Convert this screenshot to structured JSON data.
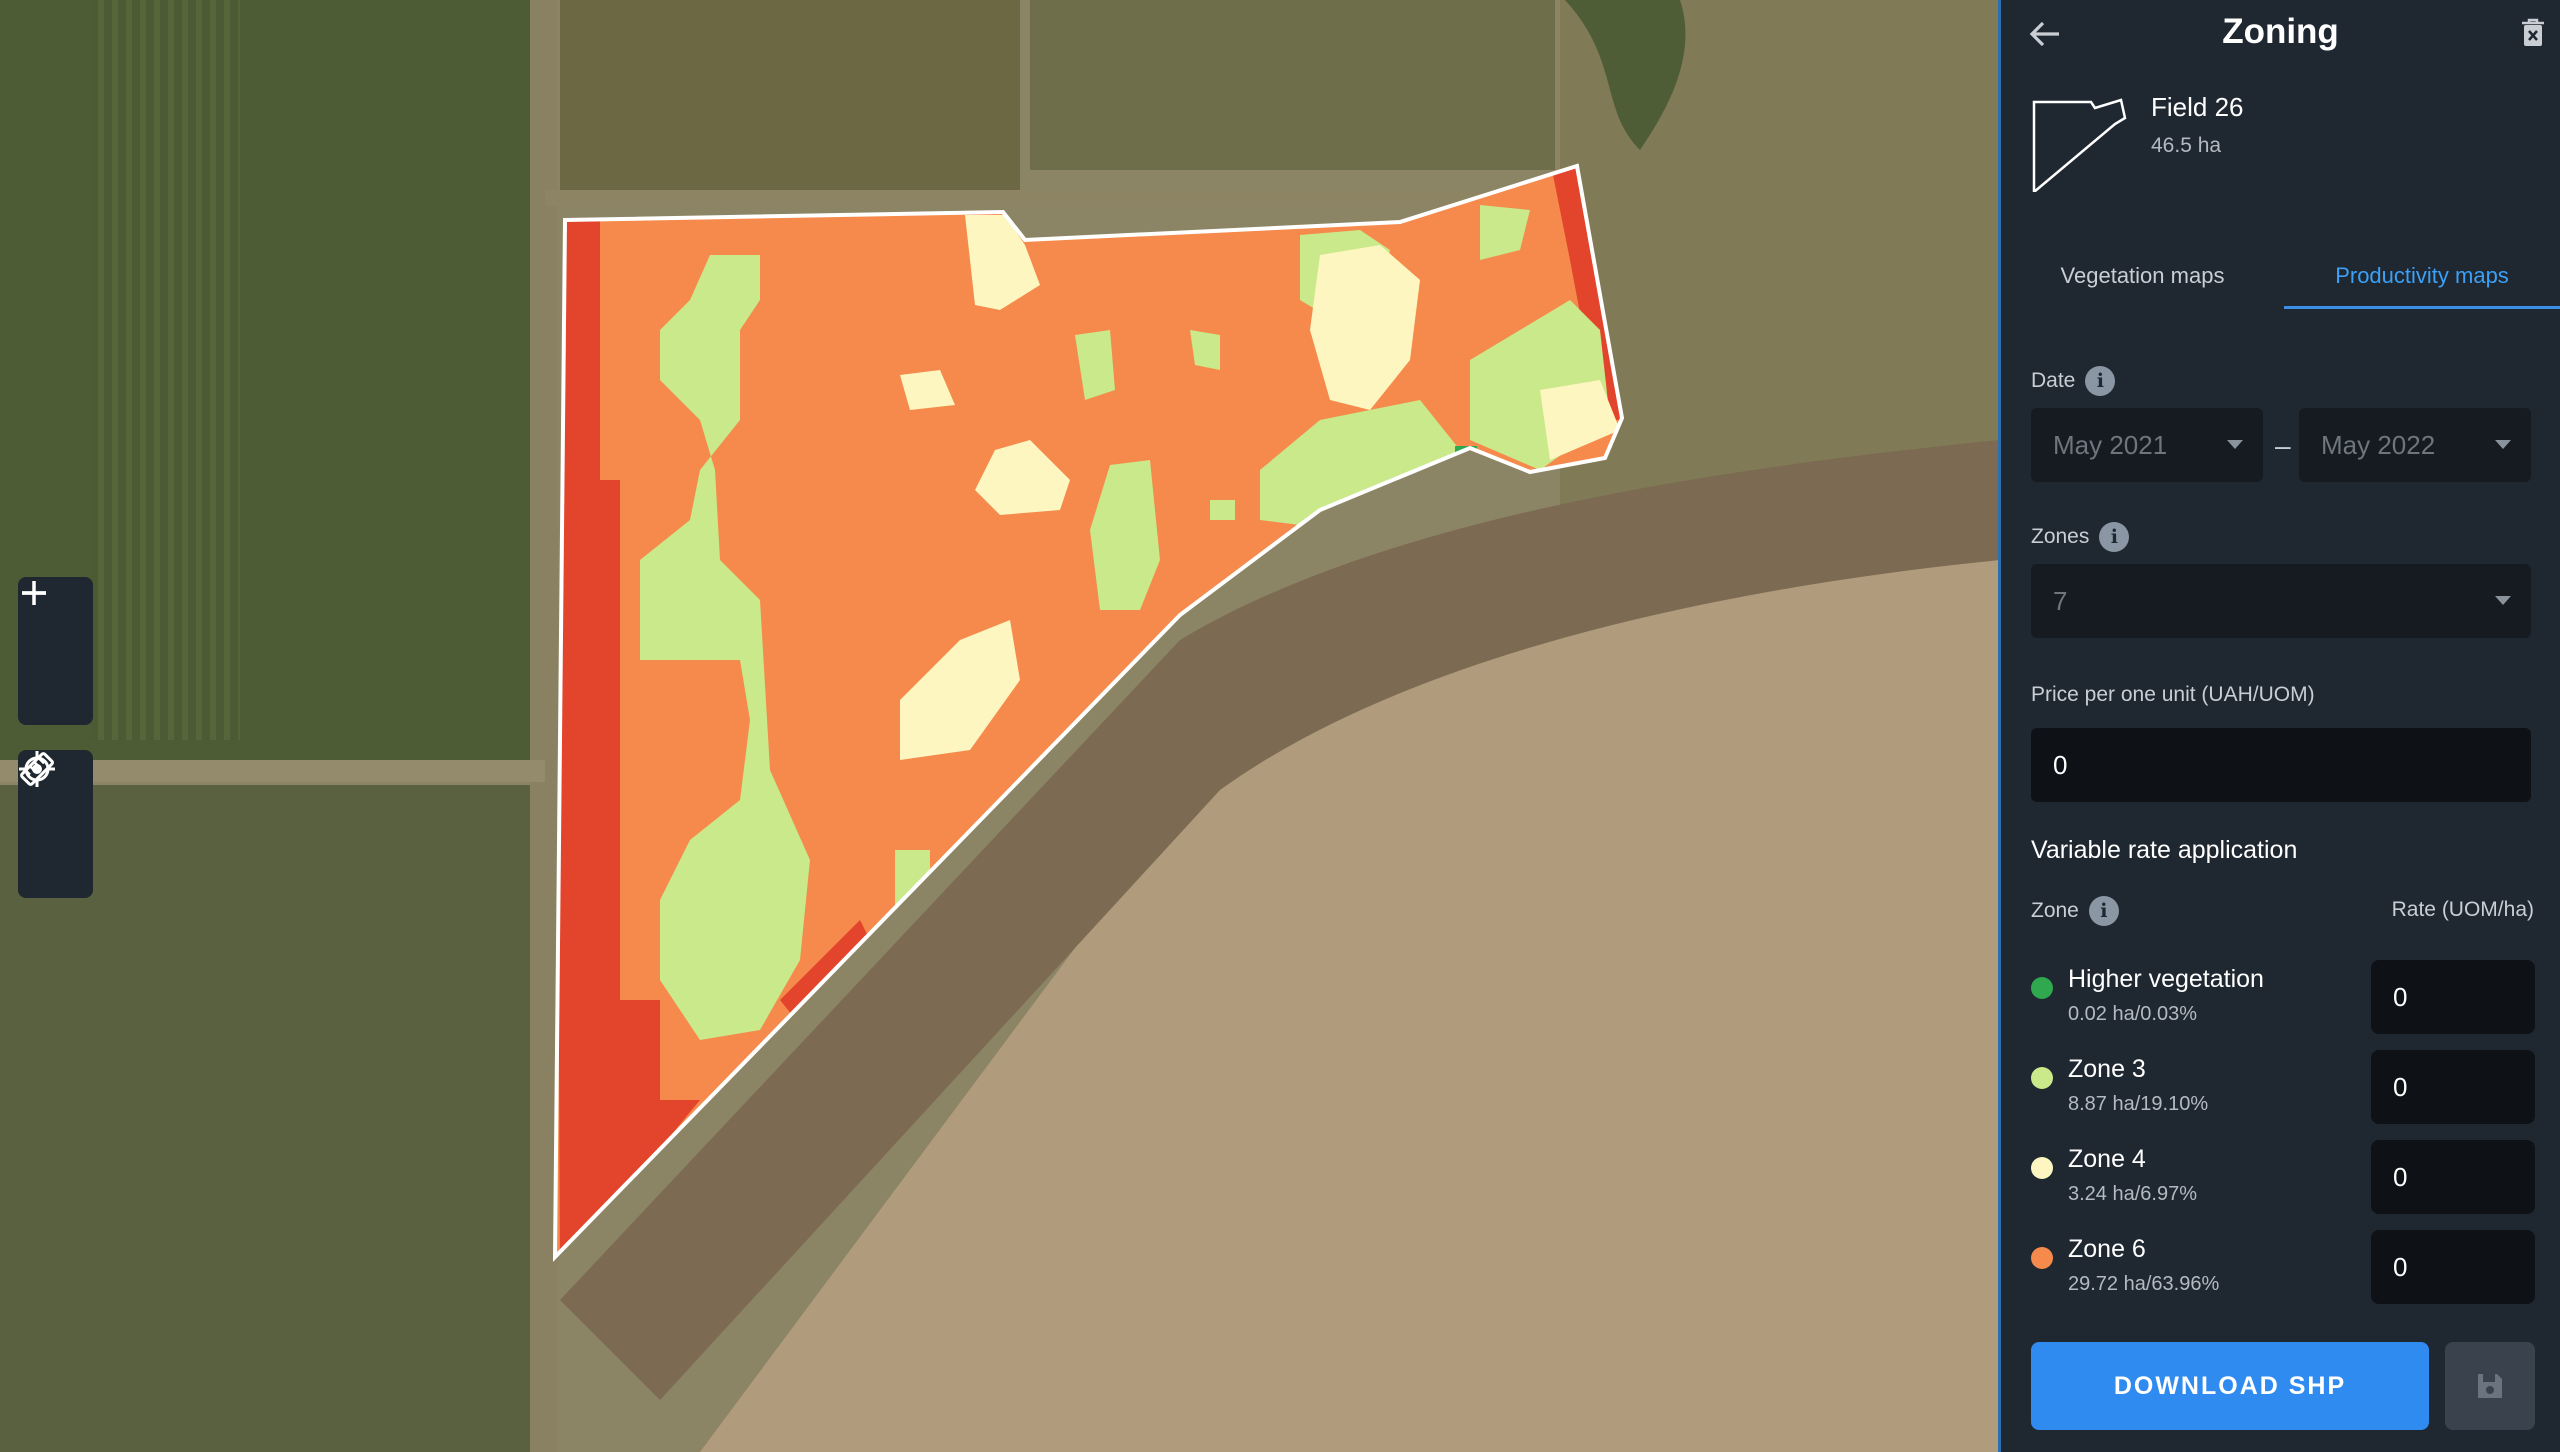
{
  "panel": {
    "title": "Zoning",
    "field_name": "Field 26",
    "field_area": "46.5 ha",
    "tabs": [
      {
        "label": "Vegetation maps",
        "active": false
      },
      {
        "label": "Productivity maps",
        "active": true
      }
    ],
    "date_label": "Date",
    "date_from": "May 2021",
    "date_to": "May 2022",
    "date_separator": "–",
    "zones_label": "Zones",
    "zones_value": "7",
    "price_label": "Price per one unit (UAH/UOM)",
    "price_value": "0",
    "var_rate_title": "Variable rate application",
    "zone_col_label": "Zone",
    "rate_col_label": "Rate (UOM/ha)",
    "zones": [
      {
        "name": "Higher vegetation",
        "area": "0.02 ha/0.03%",
        "rate": "0",
        "color": "#2fa84f"
      },
      {
        "name": "Zone 3",
        "area": "8.87 ha/19.10%",
        "rate": "0",
        "color": "#c9e98a"
      },
      {
        "name": "Zone 4",
        "area": "3.24 ha/6.97%",
        "rate": "0",
        "color": "#fdf6c0"
      },
      {
        "name": "Zone 6",
        "area": "29.72 ha/63.96%",
        "rate": "0",
        "color": "#f58a4c"
      }
    ],
    "download_label": "DOWNLOAD SHP"
  },
  "colors": {
    "accent": "#2f8bf0",
    "panel_bg": "#1f2730",
    "zone_red": "#e2452b",
    "zone_orange": "#f58a4c",
    "zone_green": "#c9e98a",
    "zone_cream": "#fdf6c0"
  },
  "icons": {
    "back": "arrow-left-icon",
    "delete": "trash-icon",
    "zoom_in": "plus-icon",
    "zoom_out": "minus-icon",
    "ruler": "ruler-icon",
    "locate": "crosshair-icon",
    "save": "floppy-disk-icon"
  }
}
